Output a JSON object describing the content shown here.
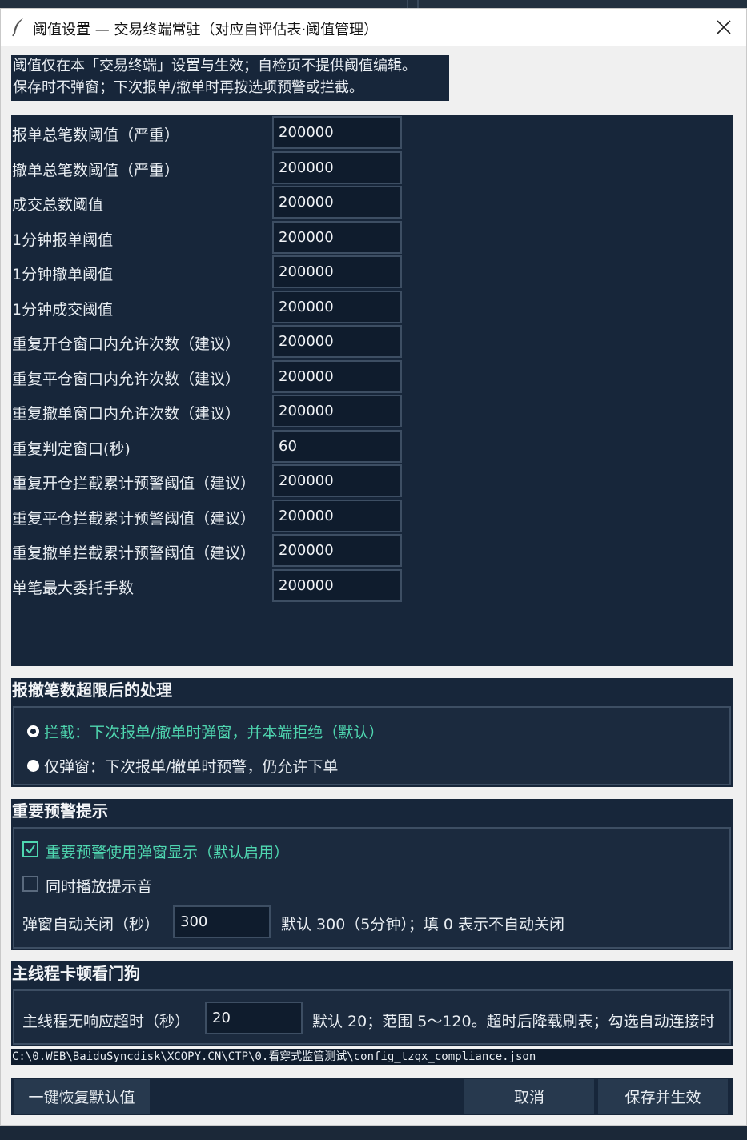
{
  "window": {
    "title": "阈值设置 — 交易终端常驻（对应自评估表·阈值管理）"
  },
  "note": {
    "line1": "阈值仅在本「交易终端」设置与生效；自检页不提供阈值编辑。",
    "line2": "保存时不弹窗；下次报单/撤单时再按选项预警或拦截。"
  },
  "fields": [
    {
      "label": "报单总笔数阈值（严重）",
      "value": "200000"
    },
    {
      "label": "撤单总笔数阈值（严重）",
      "value": "200000"
    },
    {
      "label": "成交总数阈值",
      "value": "200000"
    },
    {
      "label": "1分钟报单阈值",
      "value": "200000"
    },
    {
      "label": "1分钟撤单阈值",
      "value": "200000"
    },
    {
      "label": "1分钟成交阈值",
      "value": "200000"
    },
    {
      "label": "重复开仓窗口内允许次数（建议）",
      "value": "200000"
    },
    {
      "label": "重复平仓窗口内允许次数（建议）",
      "value": "200000"
    },
    {
      "label": "重复撤单窗口内允许次数（建议）",
      "value": "200000"
    },
    {
      "label": "重复判定窗口(秒)",
      "value": "60"
    },
    {
      "label": "重复开仓拦截累计预警阈值（建议）",
      "value": "200000"
    },
    {
      "label": "重复平仓拦截累计预警阈值（建议）",
      "value": "200000"
    },
    {
      "label": "重复撤单拦截累计预警阈值（建议）",
      "value": "200000"
    },
    {
      "label": "单笔最大委托手数",
      "value": "200000"
    }
  ],
  "overlimit": {
    "title": "报撤笔数超限后的处理",
    "options": [
      {
        "label": "拦截：下次报单/撤单时弹窗，并本端拒绝（默认）",
        "selected": true
      },
      {
        "label": "仅弹窗：下次报单/撤单时预警，仍允许下单",
        "selected": false
      }
    ]
  },
  "alerts": {
    "title": "重要预警提示",
    "popup_label": "重要预警使用弹窗显示（默认启用）",
    "popup_checked": true,
    "sound_label": "同时播放提示音",
    "sound_checked": false,
    "autoclose_label": "弹窗自动关闭（秒）",
    "autoclose_value": "300",
    "autoclose_hint": "默认 300（5分钟）；填 0 表示不自动关闭"
  },
  "watchdog": {
    "title": "主线程卡顿看门狗",
    "timeout_label": "主线程无响应超时（秒）",
    "timeout_value": "20",
    "timeout_hint": "默认 20；范围 5～120。超时后降载刷表；勾选自动连接时"
  },
  "config_path": "C:\\0.WEB\\BaiduSyncdisk\\XCOPY.CN\\CTP\\0.看穿式监管测试\\config_tzqx_compliance.json",
  "buttons": {
    "reset": "一键恢复默认值",
    "cancel": "取消",
    "save": "保存并生效"
  },
  "colors": {
    "panel": "#17263a",
    "accent_green": "#4fd7b0",
    "input_bg": "#0f1c2d"
  }
}
